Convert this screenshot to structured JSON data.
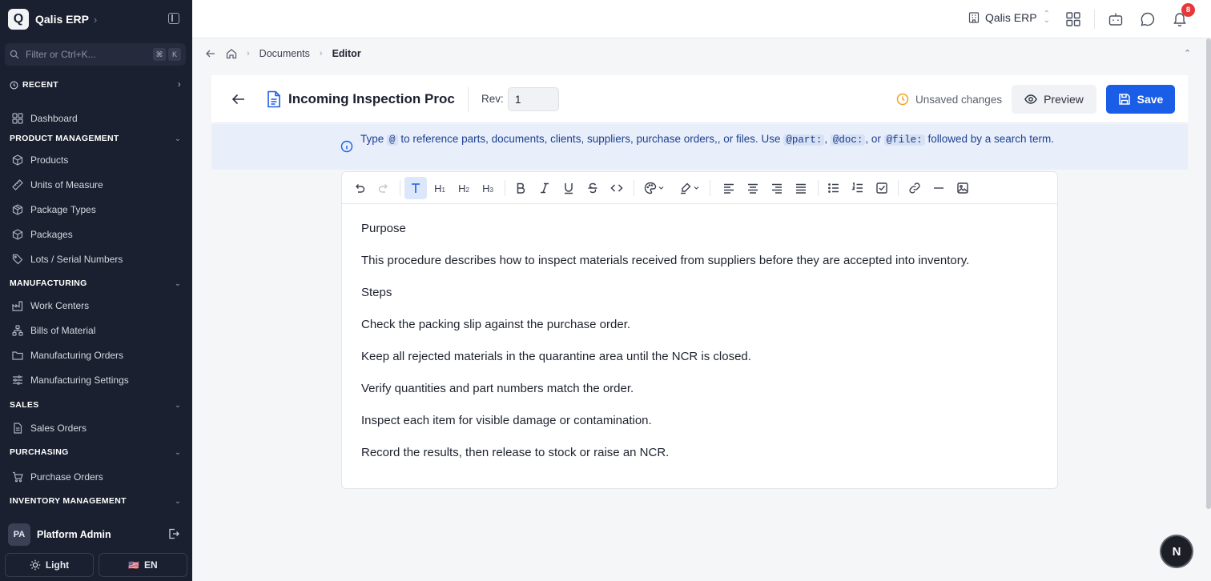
{
  "app": {
    "logo_letter": "Q",
    "brand_name": "Qalis ERP"
  },
  "sidebar": {
    "filter_placeholder": "Filter or Ctrl+K...",
    "kbd": [
      "⌘",
      "K"
    ],
    "recent_label": "RECENT",
    "dashboard": "Dashboard",
    "sections": {
      "product_management": "PRODUCT MANAGEMENT",
      "manufacturing": "MANUFACTURING",
      "sales": "SALES",
      "purchasing": "PURCHASING",
      "inventory_management": "INVENTORY MANAGEMENT"
    },
    "items": {
      "products": "Products",
      "units_of_measure": "Units of Measure",
      "package_types": "Package Types",
      "packages": "Packages",
      "lots_serial_numbers": "Lots / Serial Numbers",
      "work_centers": "Work Centers",
      "bills_of_material": "Bills of Material",
      "manufacturing_orders": "Manufacturing Orders",
      "manufacturing_settings": "Manufacturing Settings",
      "sales_orders": "Sales Orders",
      "purchase_orders": "Purchase Orders"
    },
    "user": {
      "initials": "PA",
      "name": "Platform Admin"
    },
    "theme_label": "Light",
    "language_flag": "🇺🇸",
    "language_label": "EN"
  },
  "topbar": {
    "org_name": "Qalis ERP",
    "notification_count": "8"
  },
  "breadcrumb": {
    "documents": "Documents",
    "editor": "Editor"
  },
  "document": {
    "title": "Incoming Inspection Proc",
    "rev_label": "Rev:",
    "rev_value": "1",
    "status": "Unsaved changes",
    "preview_label": "Preview",
    "save_label": "Save"
  },
  "banner": {
    "t1": "Type",
    "c1": "@",
    "t2": "to reference parts, documents, clients, suppliers, purchase orders,, or files. Use",
    "c2": "@part:",
    "t3": ",",
    "c3": "@doc:",
    "t4": ", or",
    "c4": "@file:",
    "t5": "followed by a search term."
  },
  "toolbar": {
    "h1": "H",
    "h2": "H",
    "h3": "H",
    "h1_sub": "1",
    "h2_sub": "2",
    "h3_sub": "3"
  },
  "content": {
    "paragraphs": [
      "Purpose",
      "This procedure describes how to inspect materials received from suppliers before they are accepted into inventory.",
      "Steps",
      "Check the packing slip against the purchase order.",
      "Keep all rejected materials in the quarantine area until the NCR is closed.",
      "Verify quantities and part numbers match the order.",
      "Inspect each item for visible damage or contamination.",
      "Record the results, then release to stock or raise an NCR."
    ]
  },
  "fab_letter": "N",
  "colors": {
    "sidebar_bg": "#1b2030",
    "accent": "#1a5ee8",
    "banner_bg": "#e8effb",
    "badge": "#e5383b",
    "unsaved_icon": "#f0a020"
  }
}
